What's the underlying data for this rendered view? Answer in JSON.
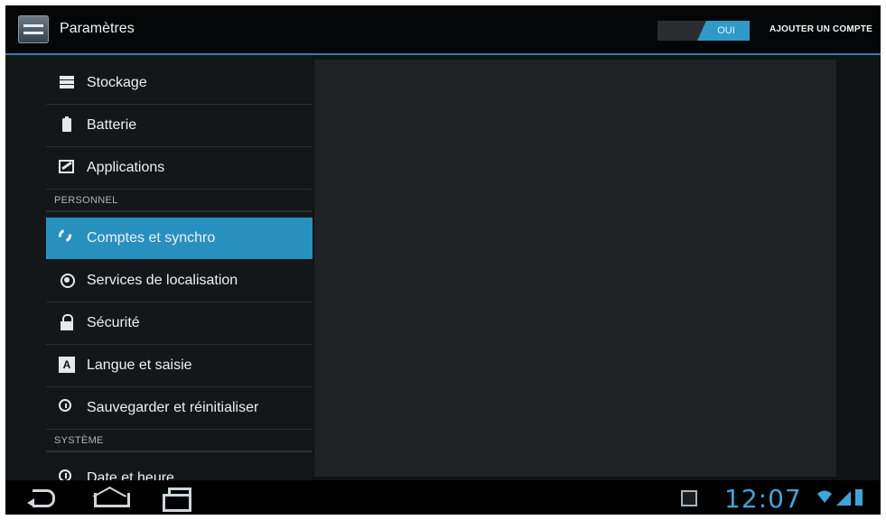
{
  "actionbar": {
    "title": "Paramètres",
    "switch_state": "OUI",
    "add_account_label": "AJOUTER UN COMPTE"
  },
  "list": {
    "items": [
      {
        "label": "Stockage",
        "icon": "storage-icon"
      },
      {
        "label": "Batterie",
        "icon": "battery-icon"
      },
      {
        "label": "Applications",
        "icon": "applications-icon"
      },
      {
        "label": "Comptes et synchro",
        "icon": "sync-icon",
        "selected": true
      },
      {
        "label": "Services de localisation",
        "icon": "location-icon"
      },
      {
        "label": "Sécurité",
        "icon": "lock-icon"
      },
      {
        "label": "Langue et saisie",
        "icon": "language-icon"
      },
      {
        "label": "Sauvegarder et réinitialiser",
        "icon": "backup-restore-icon"
      },
      {
        "label": "Date et heure",
        "icon": "clock-icon"
      }
    ],
    "sections": {
      "personal": "PERSONNEL",
      "system": "SYSTÈME"
    }
  },
  "statusbar": {
    "time": "12:07"
  },
  "colors": {
    "accent": "#2f9ac8",
    "selected_bg": "#2790bf",
    "clock": "#3ea5d9"
  }
}
